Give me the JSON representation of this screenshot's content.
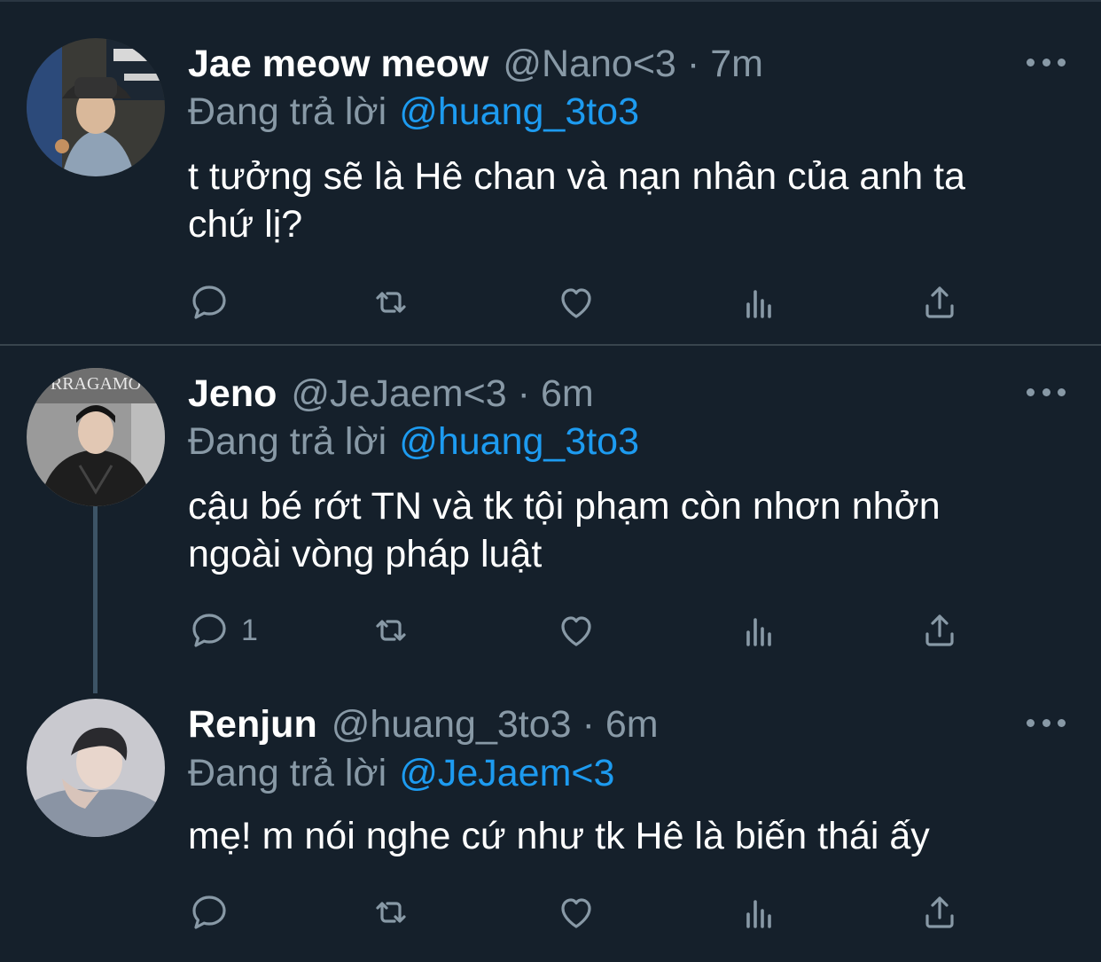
{
  "tweets": [
    {
      "display_name": "Jae meow meow",
      "handle": "@Nano<3",
      "separator": "·",
      "time": "7m",
      "reply_prefix": "Đang trả lời",
      "reply_to": "@huang_3to3",
      "body_lines": [
        "t tưởng sẽ là Hê chan và nạn nhân của anh ta",
        "chứ lị?"
      ],
      "reply_count": "",
      "avatar_icon": "avatar-bucket-hat-photo"
    },
    {
      "display_name": "Jeno",
      "handle": "@JeJaem<3",
      "separator": "·",
      "time": "6m",
      "reply_prefix": "Đang trả lời",
      "reply_to": "@huang_3to3",
      "body_lines": [
        "cậu bé rớt TN và tk tội phạm còn nhơn nhởn",
        "ngoài vòng pháp luật"
      ],
      "reply_count": "1",
      "avatar_icon": "avatar-leather-jacket-photo",
      "avatar_sign_text": "RRAGAMO"
    },
    {
      "display_name": "Renjun",
      "handle": "@huang_3to3",
      "separator": "·",
      "time": "6m",
      "reply_prefix": "Đang trả lời",
      "reply_to": "@JeJaem<3",
      "body_lines": [
        "mẹ! m nói nghe cứ như tk Hê là biến thái ấy"
      ],
      "reply_count": "",
      "avatar_icon": "avatar-hoodie-photo"
    }
  ],
  "action_icons": [
    "reply-icon",
    "retweet-icon",
    "like-icon",
    "analytics-icon",
    "share-icon"
  ],
  "colors": {
    "background": "#15202b",
    "divider": "#38444d",
    "text": "#ffffff",
    "secondary": "#8899a6",
    "link": "#1d9bf0"
  }
}
